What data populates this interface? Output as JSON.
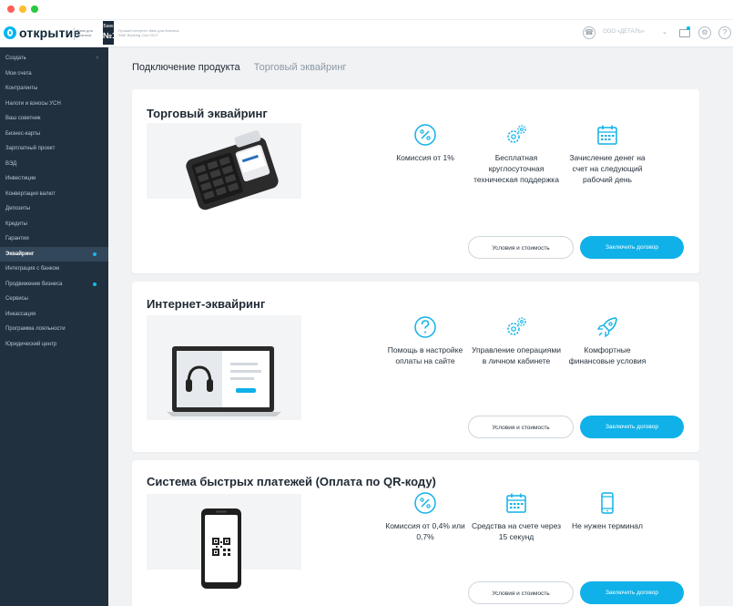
{
  "header": {
    "logo_text": "открытие",
    "logo_sub": "Банк для бизнеса",
    "badge_top": "Банк",
    "badge_num": "№1",
    "badge_text": "Лучший интернет-банк для бизнеса. SME Banking Club 2017",
    "user_name": "ООО «ДЕТАЛЬ»"
  },
  "sidebar": {
    "items": [
      {
        "label": "Создать"
      },
      {
        "label": "Мои счета"
      },
      {
        "label": "Контрагенты"
      },
      {
        "label": "Налоги и взносы УСН"
      },
      {
        "label": "Ваш советник"
      },
      {
        "label": "Бизнес-карты"
      },
      {
        "label": "Зарплатный проект"
      },
      {
        "label": "ВЭД"
      },
      {
        "label": "Инвестиции"
      },
      {
        "label": "Конвертация валют"
      },
      {
        "label": "Депозиты"
      },
      {
        "label": "Кредиты"
      },
      {
        "label": "Гарантии"
      },
      {
        "label": "Эквайринг"
      },
      {
        "label": "Интеграция с банком"
      },
      {
        "label": "Продвижение бизнеса"
      },
      {
        "label": "Сервисы"
      },
      {
        "label": "Инкассация"
      },
      {
        "label": "Программа лояльности"
      },
      {
        "label": "Юридический центр"
      }
    ]
  },
  "breadcrumb": {
    "parent": "Подключение продукта",
    "current": "Торговый эквайринг"
  },
  "cards": [
    {
      "title": "Торговый эквайринг",
      "features": [
        {
          "icon": "percent-icon",
          "label": "Комиссия от 1%"
        },
        {
          "icon": "gears-icon",
          "label": "Бесплатная круглосуточная техническая поддержка"
        },
        {
          "icon": "calendar-icon",
          "label": "Зачисление денег на счет на следующий рабочий день"
        }
      ],
      "btn_terms": "Условия и стоимость",
      "btn_contract": "Заключить договор"
    },
    {
      "title": "Интернет-эквайринг",
      "features": [
        {
          "icon": "question-icon",
          "label": "Помощь в настройке оплаты на сайте"
        },
        {
          "icon": "gears-icon",
          "label": "Управление операциями в личном кабинете"
        },
        {
          "icon": "rocket-icon",
          "label": "Комфортные финансовые условия"
        }
      ],
      "btn_terms": "Условия и стоимость",
      "btn_contract": "Заключить договор"
    },
    {
      "title": "Система быстрых платежей (Оплата по QR-коду)",
      "features": [
        {
          "icon": "percent-icon",
          "label": "Комиссия от 0,4% или 0,7%"
        },
        {
          "icon": "calendar-icon",
          "label": "Средства на счете через 15 секунд"
        },
        {
          "icon": "smartphone-icon",
          "label": "Не нужен терминал"
        }
      ],
      "btn_terms": "Условия и стоимость",
      "btn_contract": "Заключить договор"
    }
  ],
  "colors": {
    "accent": "#0fb1e8",
    "sidebar_bg": "#20303f",
    "sidebar_active": "#33475a"
  }
}
